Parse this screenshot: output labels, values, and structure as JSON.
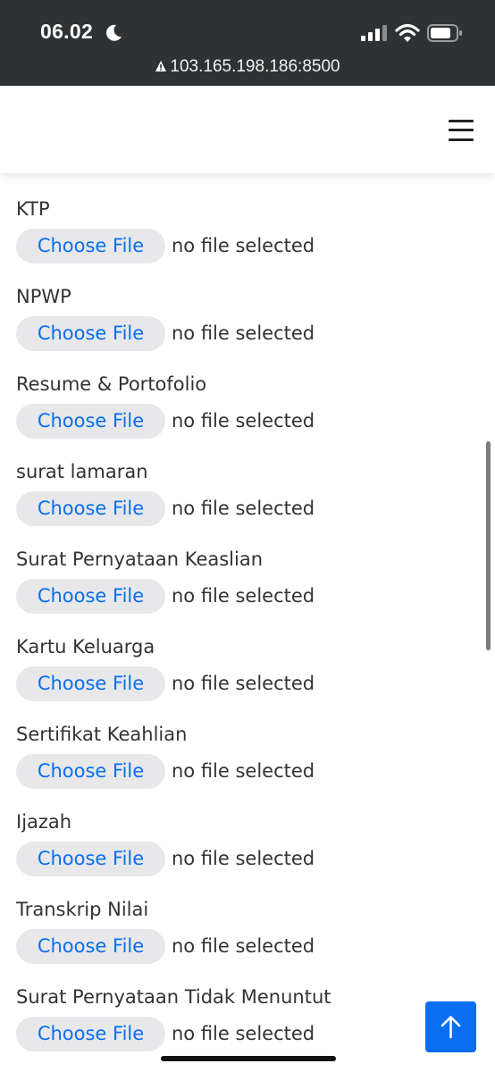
{
  "status_bar": {
    "time": "06.02",
    "url": "103.165.198.186:8500",
    "icons": [
      "moon-icon",
      "signal-icon",
      "wifi-icon",
      "battery-icon",
      "warning-icon"
    ]
  },
  "navbar": {
    "menu_icon": "hamburger-menu-icon"
  },
  "form": {
    "fields": [
      {
        "label": "KTP",
        "button": "Choose File",
        "status": "no file selected"
      },
      {
        "label": "NPWP",
        "button": "Choose File",
        "status": "no file selected"
      },
      {
        "label": "Resume & Portofolio",
        "button": "Choose File",
        "status": "no file selected"
      },
      {
        "label": "surat lamaran",
        "button": "Choose File",
        "status": "no file selected"
      },
      {
        "label": "Surat Pernyataan Keaslian",
        "button": "Choose File",
        "status": "no file selected"
      },
      {
        "label": "Kartu Keluarga",
        "button": "Choose File",
        "status": "no file selected"
      },
      {
        "label": "Sertifikat Keahlian",
        "button": "Choose File",
        "status": "no file selected"
      },
      {
        "label": "Ijazah",
        "button": "Choose File",
        "status": "no file selected"
      },
      {
        "label": "Transkrip Nilai",
        "button": "Choose File",
        "status": "no file selected"
      },
      {
        "label": "Surat Pernyataan Tidak Menuntut",
        "button": "Choose File",
        "status": "no file selected"
      }
    ]
  },
  "back_to_top": {
    "icon": "arrow-up-icon"
  },
  "colors": {
    "status_bar_bg": "#2f3234",
    "accent": "#0a6ef1",
    "button_bg": "#e8e8ea",
    "text": "#333333"
  }
}
